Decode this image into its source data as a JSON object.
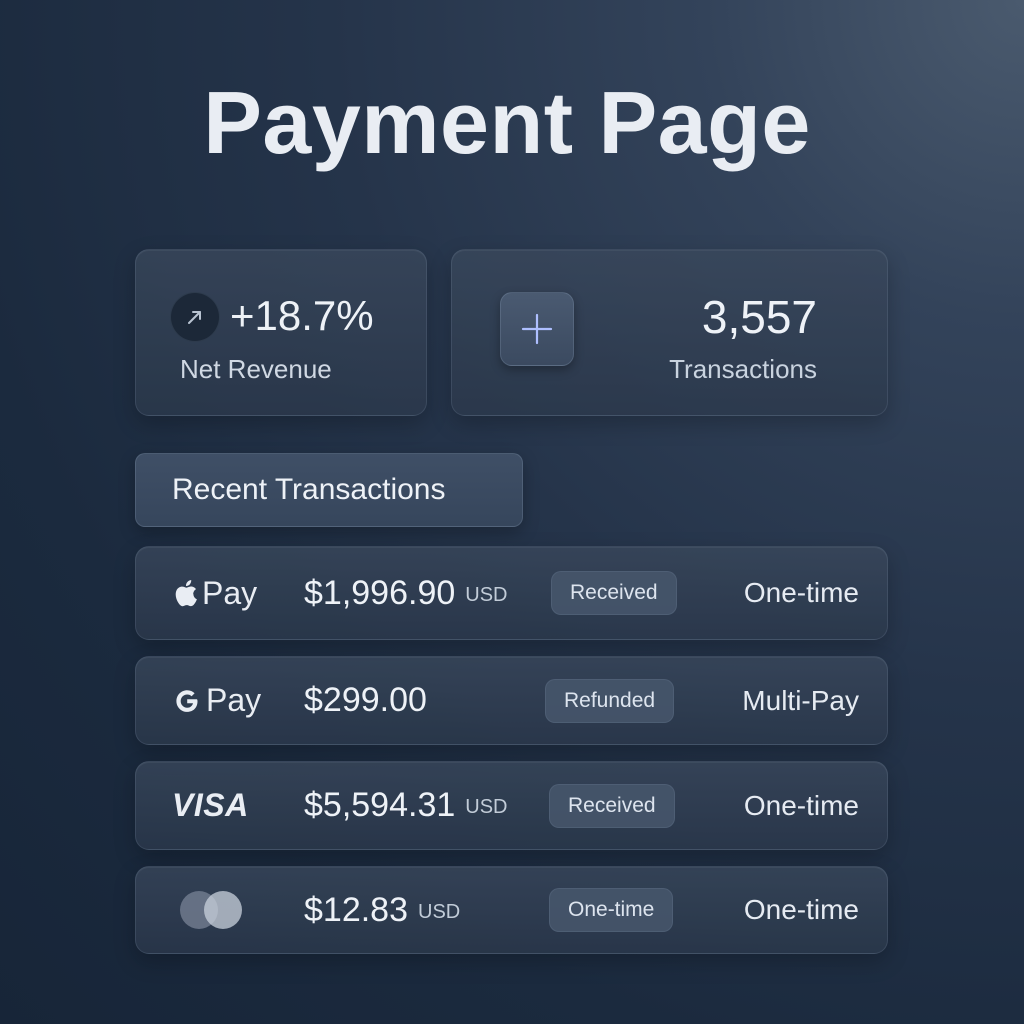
{
  "page": {
    "title": "Payment Page"
  },
  "stats": {
    "net_revenue": {
      "value": "+18.7%",
      "label": "Net Revenue",
      "icon": "trend-up-icon"
    },
    "transactions": {
      "value": "3,557",
      "label": "Transactions",
      "icon": "plus-icon"
    }
  },
  "section": {
    "title": "Recent Transactions"
  },
  "transactions": [
    {
      "method": "Pay",
      "method_icon": "apple-icon",
      "amount": "$1,996.90",
      "currency": "USD",
      "status": "Received",
      "plan": "One-time"
    },
    {
      "method": "Pay",
      "method_icon": "google-g-icon",
      "amount": "$299.00",
      "currency": "",
      "status": "Refunded",
      "plan": "Multi-Pay"
    },
    {
      "method": "VISA",
      "method_icon": "visa-logo",
      "amount": "$5,594.31",
      "currency": "USD",
      "status": "Received",
      "plan": "One-time"
    },
    {
      "method": "",
      "method_icon": "mastercard-icon",
      "amount": "$12.83",
      "currency": "USD",
      "status": "One-time",
      "plan": "One-time"
    }
  ],
  "colors": {
    "background_top": "#4a5a6e",
    "background_bottom": "#172538",
    "card": "#3a485c",
    "badge": "#46556a",
    "accent_plus": "#aebfff"
  }
}
